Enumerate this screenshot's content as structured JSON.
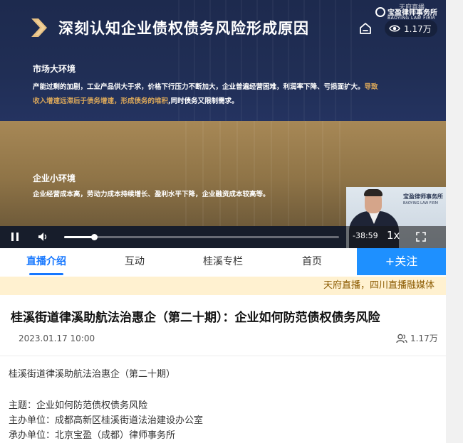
{
  "video": {
    "slide_title": "深刻认知企业债权债务风险形成原因",
    "overlay_tag": "天府直播",
    "logo_name": "宝盈律师事务所",
    "logo_sub": "BAOYING LAW FIRM",
    "views": "1.17万",
    "section1": {
      "heading": "市场大环境",
      "line1": "产能过剩的加剧，工业产品供大于求，价格下行压力不断加大，企业普遍经营困难，利润率下降、亏损面扩大。",
      "line1_highlight": "导致",
      "line2_highlight": "收入增速远滞后于债务增速，形成债务的堆积",
      "line2": ",同时债务又限制需求。"
    },
    "section2": {
      "heading": "企业小环境",
      "body": "企业经营成本高，劳动力成本持续增长、盈利水平下降，企业融资成本较高等。"
    },
    "pip_logo": "宝盈律师事务所",
    "pip_logo_sub": "BAOYING LAW FIRM",
    "controls": {
      "time_left": "-38:59",
      "speed": "1x",
      "progress": 0.11
    }
  },
  "tabs": [
    {
      "label": "直播介绍",
      "active": true
    },
    {
      "label": "互动",
      "active": false
    },
    {
      "label": "桂溪专栏",
      "active": false
    },
    {
      "label": "首页",
      "active": false
    }
  ],
  "follow_label": "+关注",
  "notice": "天府直播，四川直播融媒体",
  "article": {
    "title": "桂溪街道律溪助航法治惠企（第二十期）：企业如何防范债权债务风险",
    "date": "2023.01.17 10:00",
    "views": "1.17万",
    "lines": [
      "桂溪街道律溪助航法治惠企（第二十期）",
      "",
      "主题：企业如何防范债权债务风险",
      "主办单位：成都高新区桂溪街道法治建设办公室",
      "承办单位：北京宝盈（成都）律师事务所"
    ]
  },
  "colors": {
    "accent": "#1677ff",
    "follow_button": "#1e90ff",
    "highlight": "#d8a65a",
    "notice_bg": "#fff1d0",
    "notice_text": "#8b5a00"
  },
  "icons": [
    "chevron-logo-icon",
    "home-icon",
    "eye-icon",
    "play-pause-icon",
    "volume-icon",
    "fullscreen-icon",
    "users-icon"
  ]
}
